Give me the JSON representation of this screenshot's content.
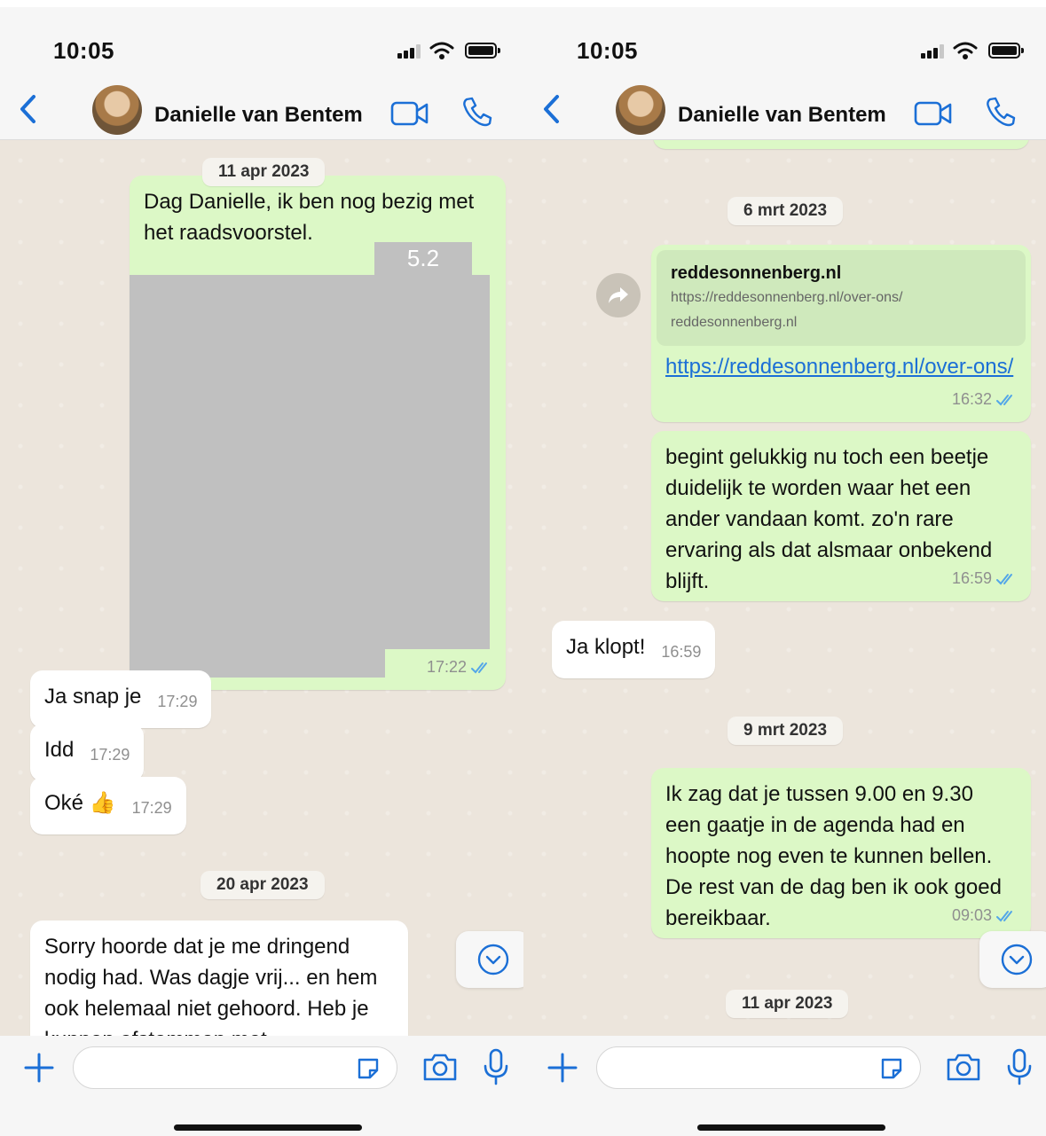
{
  "status_bar": {
    "time": "10:05"
  },
  "header": {
    "contact_name": "Danielle van Bentem"
  },
  "left": {
    "date_1": "11 apr 2023",
    "msg_1_text": "Dag Danielle, ik ben nog bezig met het raadsvoorstel.",
    "msg_1_redaction_label": "5.2",
    "msg_1_time": "17:22",
    "msg_2_text": "Ja snap je",
    "msg_2_time": "17:29",
    "msg_3_text": "Idd",
    "msg_3_time": "17:29",
    "msg_4_text": "Oké 👍",
    "msg_4_time": "17:29",
    "date_2": "20 apr 2023",
    "msg_5_text": "Sorry hoorde dat je me dringend nodig had. Was dagje vrij... en hem ook helemaal niet gehoord. Heb je kunnen afstemmen met"
  },
  "right": {
    "date_1": "6 mrt 2023",
    "link_title": "reddesonnenberg.nl",
    "link_url_preview": "https://reddesonnenberg.nl/over-ons/",
    "link_domain": "reddesonnenberg.nl",
    "link_text": "https://reddesonnenberg.nl/over-ons/",
    "msg_1_time": "16:32",
    "msg_2_text": "begint gelukkig nu toch een beetje duidelijk te worden waar het een ander vandaan komt. zo'n rare ervaring als dat alsmaar onbekend blijft.",
    "msg_2_time": "16:59",
    "msg_3_text": "Ja klopt!",
    "msg_3_time": "16:59",
    "date_2": "9 mrt 2023",
    "msg_4_text": "Ik zag dat je tussen 9.00 en 9.30 een gaatje in de agenda had en hoopte nog even te kunnen bellen. De rest van de dag ben ik ook goed bereikbaar.",
    "msg_4_time": "09:03",
    "date_3": "11 apr 2023"
  },
  "colors": {
    "outgoing_bubble": "#dcf8c6",
    "incoming_bubble": "#ffffff",
    "chat_background": "#ece5dc",
    "accent_blue": "#1b6fd6",
    "read_ticks": "#53a6e8",
    "redaction": "#c0c0c0"
  },
  "icons": [
    "back-chevron-icon",
    "video-call-icon",
    "phone-call-icon",
    "plus-icon",
    "sticker-icon",
    "camera-icon",
    "microphone-icon",
    "forward-icon",
    "scroll-down-icon",
    "read-ticks-icon",
    "signal-icon",
    "wifi-icon",
    "battery-icon"
  ]
}
